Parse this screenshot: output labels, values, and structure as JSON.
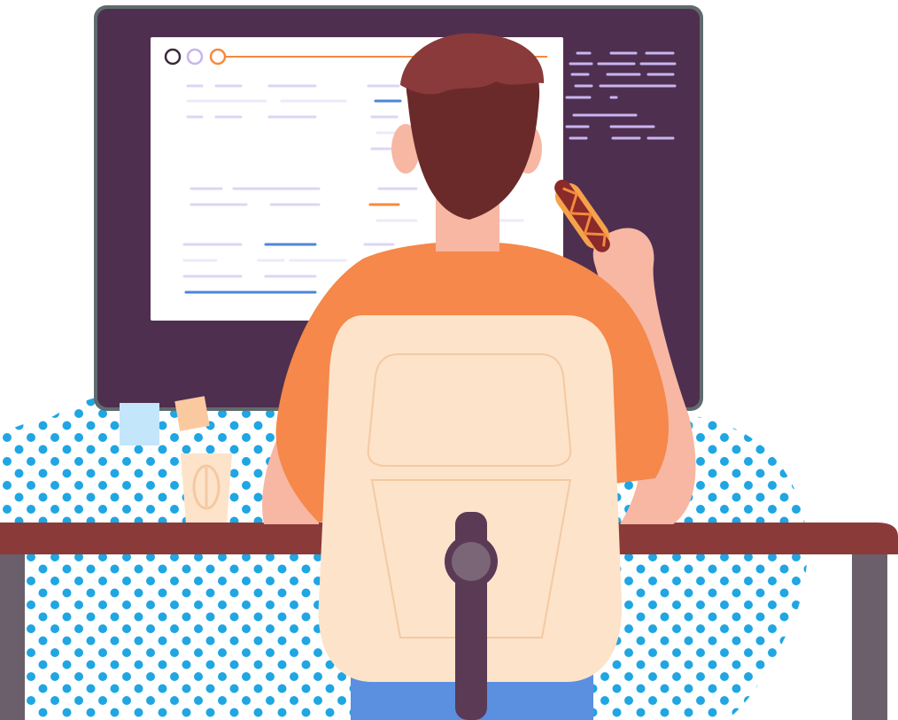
{
  "scene": {
    "subject": "person-at-desk-eating-hotdog-back-view",
    "colors": {
      "monitor_frame": "#5f6b6d",
      "monitor_screen": "#4f2f4f",
      "window_bg": "#ffffff",
      "code_lines": "#c8b4f0",
      "text_line_light": "#dcd6f5",
      "text_line_blue": "#4f86d8",
      "text_line_orange": "#f5893d",
      "dot_pattern": "#1fa6e3",
      "shirt": "#f5884a",
      "skin": "#f7b7a3",
      "hair": "#6b2a2a",
      "hair_highlight": "#8a3a3a",
      "chair_back": "#fde3ca",
      "chair_outline": "#f4c9a2",
      "chair_post": "#5a3a55",
      "chair_knob": "#7a6676",
      "desk_top": "#8b3a3a",
      "desk_legs": "#6b5f6b",
      "pants": "#5b8fe0",
      "cup": "#fde3ca",
      "sticky_note_blue": "#c3e6fb",
      "sticky_note_peach": "#fbc9a0",
      "hotdog_bun": "#f5a24a",
      "hotdog_sausage": "#8b2a2a",
      "window_dot_dark": "#3a2a3a",
      "window_dot_light": "#c8b4f0",
      "window_dot_orange": "#f5893d"
    },
    "icons": [
      "window-control-icon",
      "hotdog-icon",
      "coffee-cup-icon",
      "sticky-note-icon"
    ]
  }
}
